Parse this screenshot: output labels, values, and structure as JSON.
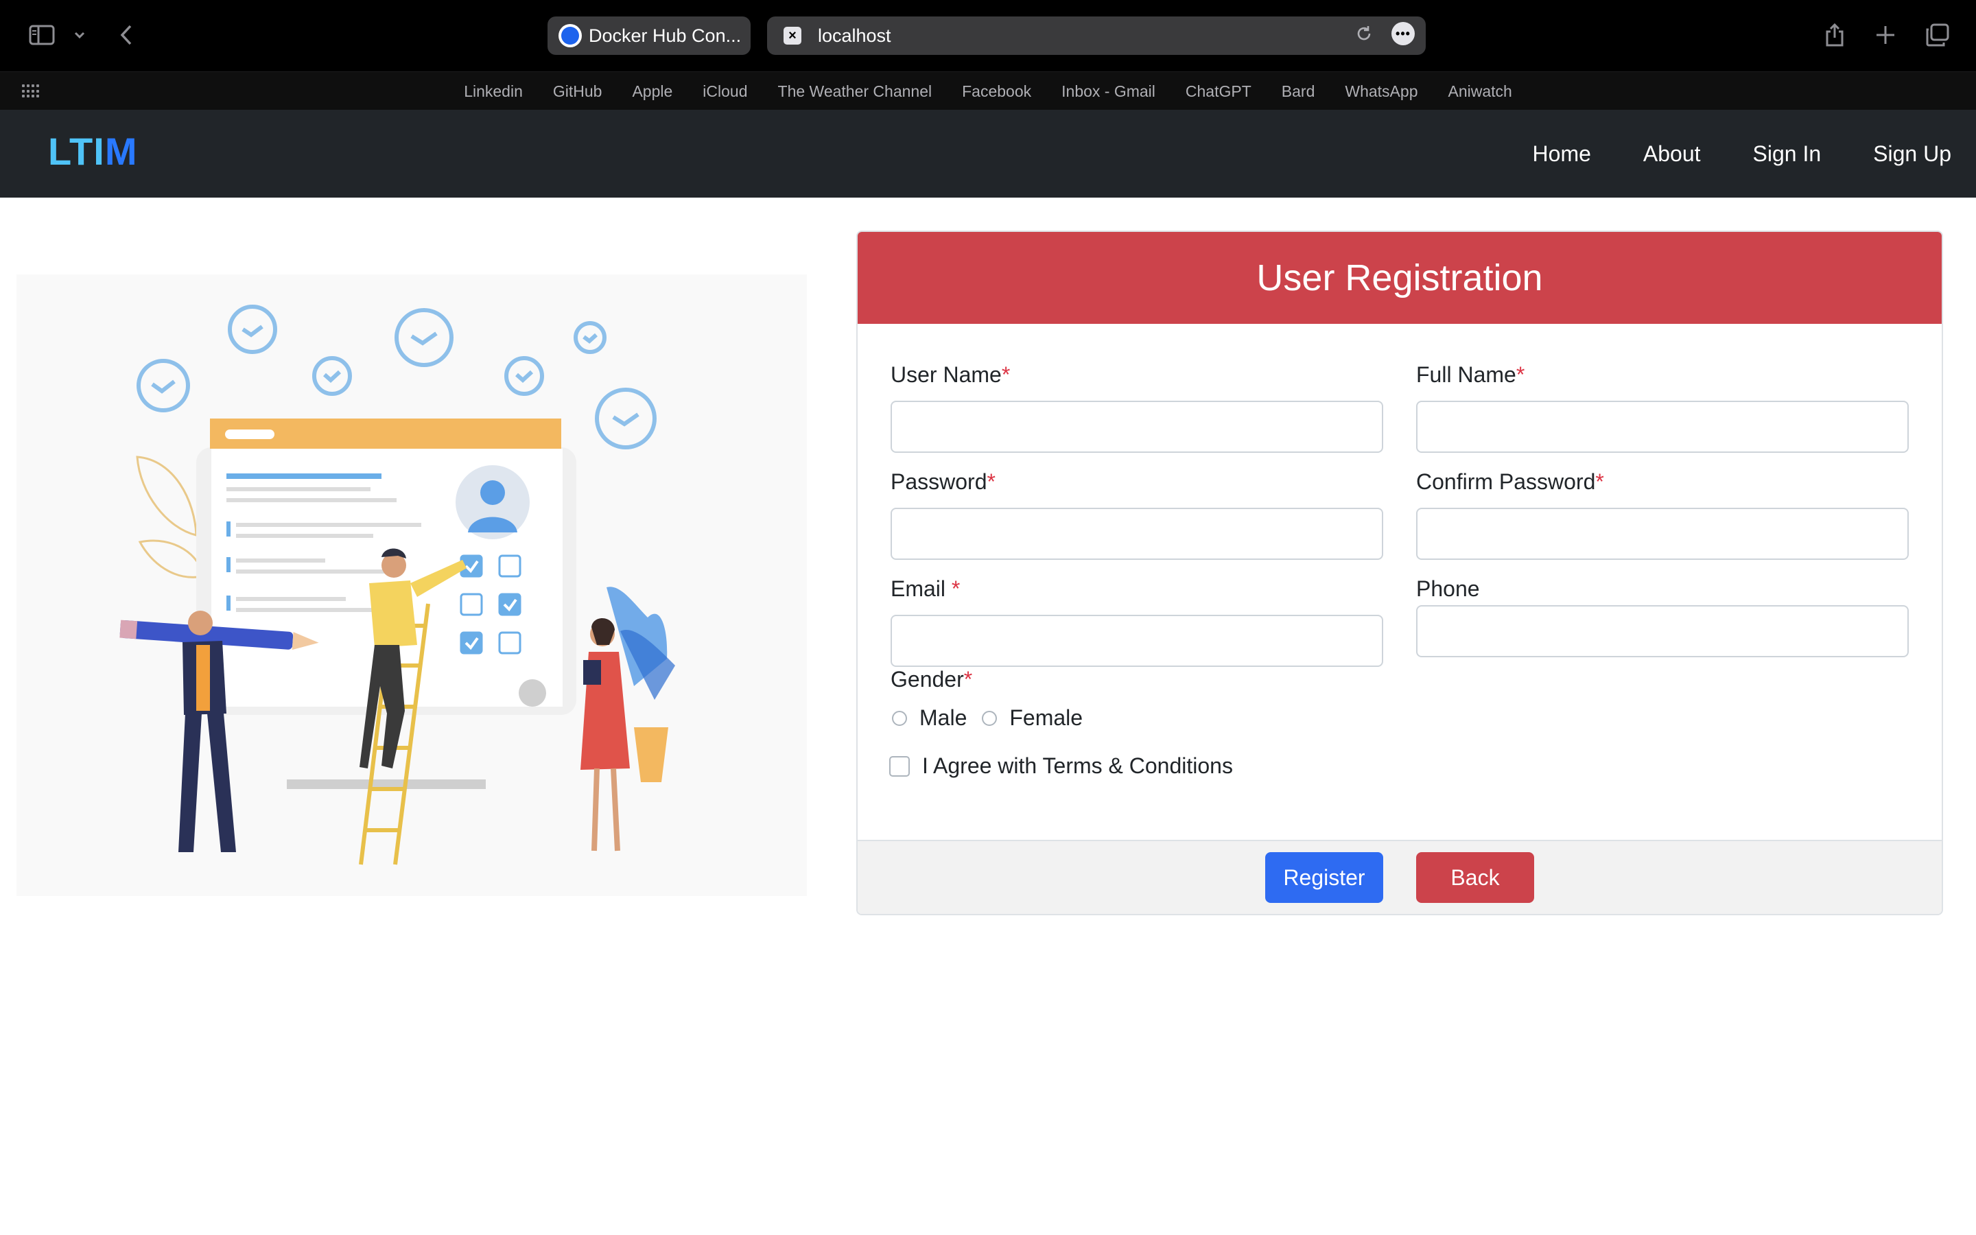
{
  "browser": {
    "tabs": [
      {
        "title": "Docker Hub Con...",
        "active": false
      },
      {
        "title": "localhost",
        "active": true
      }
    ],
    "bookmarks": [
      "Linkedin",
      "GitHub",
      "Apple",
      "iCloud",
      "The Weather Channel",
      "Facebook",
      "Inbox - Gmail",
      "ChatGPT",
      "Bard",
      "WhatsApp",
      "Aniwatch"
    ]
  },
  "navbar": {
    "brand_part1": "LTI",
    "brand_part2": "M",
    "links": [
      "Home",
      "About",
      "Sign In",
      "Sign Up"
    ]
  },
  "form": {
    "title": "User Registration",
    "required_mark": "*",
    "fields": {
      "username": {
        "label": "User Name",
        "value": ""
      },
      "fullname": {
        "label": "Full Name",
        "value": ""
      },
      "password": {
        "label": "Password",
        "value": ""
      },
      "confirm_password": {
        "label": "Confirm Password",
        "value": ""
      },
      "email": {
        "label": "Email",
        "value": ""
      },
      "phone": {
        "label": "Phone",
        "value": ""
      }
    },
    "gender": {
      "label": "Gender",
      "options": [
        "Male",
        "Female"
      ]
    },
    "terms_label": "I Agree with Terms & Conditions",
    "buttons": {
      "register": "Register",
      "back": "Back"
    }
  },
  "colors": {
    "header_red": "#cc434b",
    "primary_blue": "#2e6bf2",
    "navbar_dark": "#212529",
    "brand_light_blue": "#4fc3f7",
    "brand_blue": "#2979ff"
  }
}
